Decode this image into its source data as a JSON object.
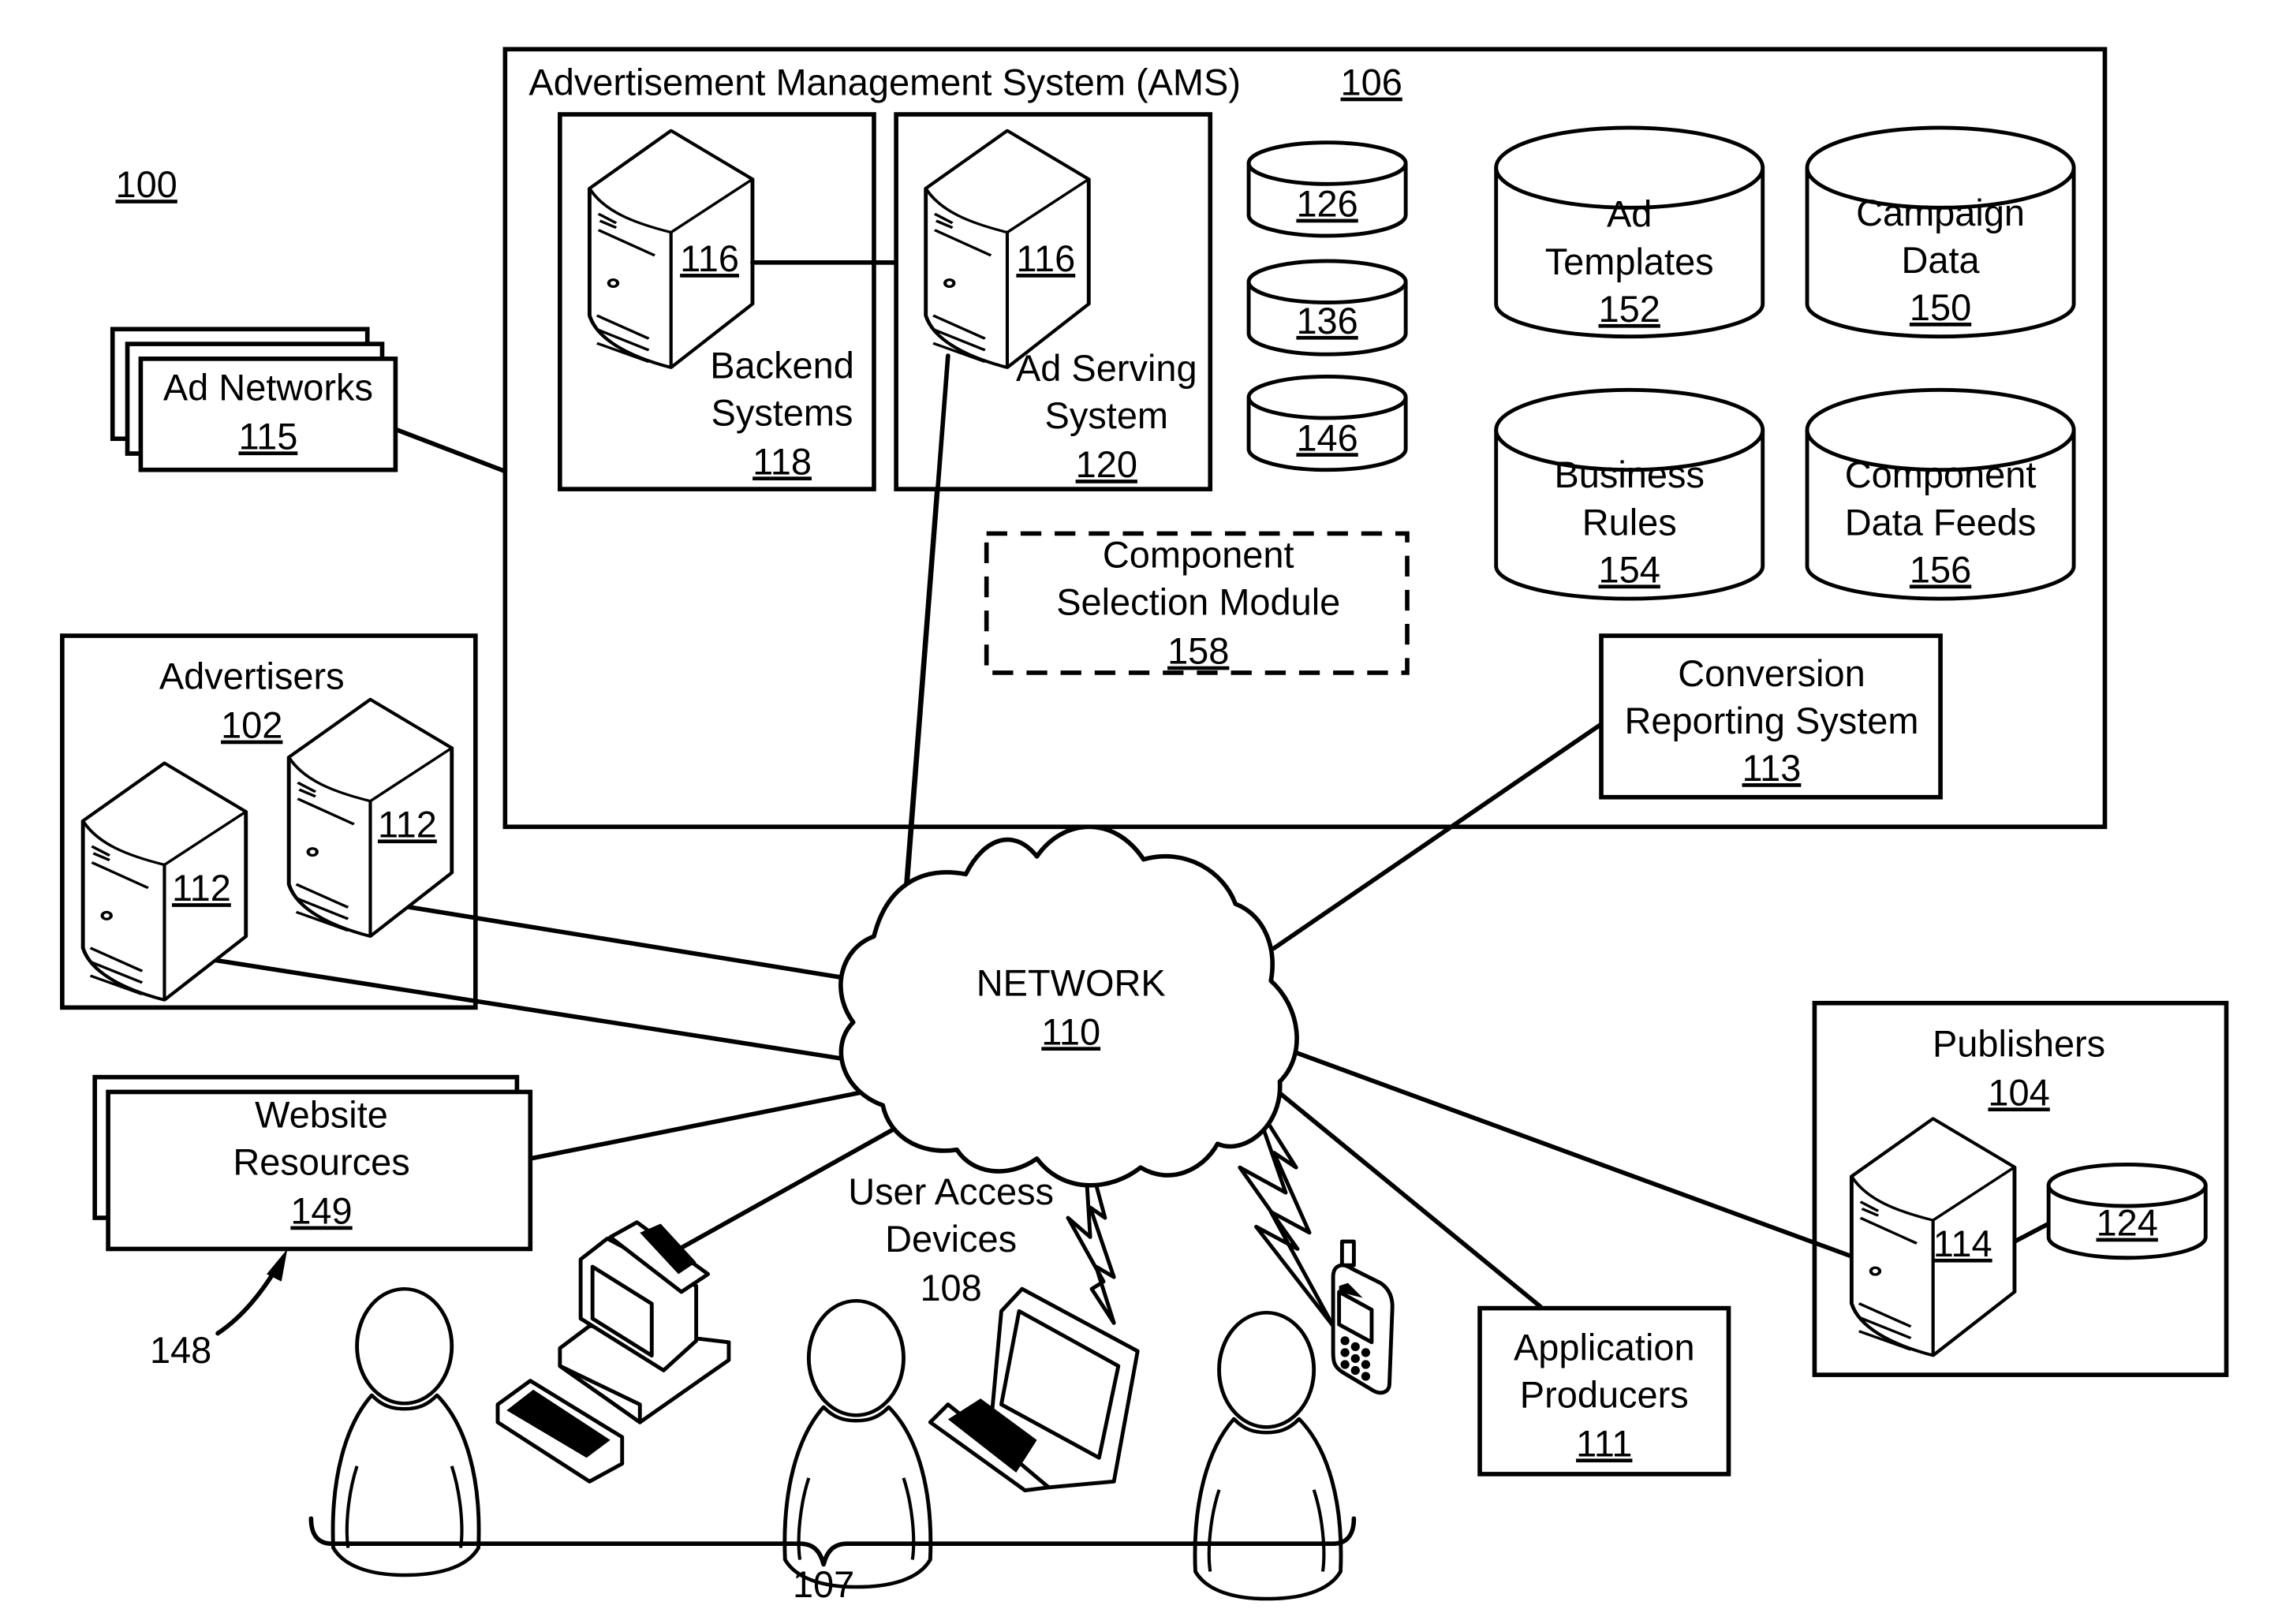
{
  "figure": {
    "ref": "100",
    "colors": {
      "line": "#000000",
      "background": "#ffffff"
    }
  },
  "ams": {
    "title": "Advertisement Management System (AMS)",
    "ref": "106"
  },
  "backend": {
    "line1": "Backend",
    "line2": "Systems",
    "ref": "118",
    "server_ref": "116"
  },
  "ad_serving": {
    "line1": "Ad Serving",
    "line2": "System",
    "ref": "120",
    "server_ref": "116"
  },
  "small_dbs": [
    {
      "ref": "126"
    },
    {
      "ref": "136"
    },
    {
      "ref": "146"
    }
  ],
  "data_stores": [
    {
      "line1": "Ad",
      "line2": "Templates",
      "ref": "152"
    },
    {
      "line1": "Campaign",
      "line2": "Data",
      "ref": "150"
    },
    {
      "line1": "Business",
      "line2": "Rules",
      "ref": "154"
    },
    {
      "line1": "Component",
      "line2": "Data Feeds",
      "ref": "156"
    }
  ],
  "component_selection": {
    "line1": "Component",
    "line2": "Selection Module",
    "ref": "158"
  },
  "conversion_reporting": {
    "line1": "Conversion",
    "line2": "Reporting System",
    "ref": "113"
  },
  "ad_networks": {
    "label": "Ad Networks",
    "ref": "115"
  },
  "advertisers": {
    "label": "Advertisers",
    "ref": "102",
    "server_refs": [
      "112",
      "112"
    ]
  },
  "website_resources": {
    "line1": "Website",
    "line2": "Resources",
    "ref": "149",
    "pointer_ref": "148"
  },
  "network": {
    "label": "NETWORK",
    "ref": "110"
  },
  "user_access_devices": {
    "line1": "User Access",
    "line2": "Devices",
    "ref": "108"
  },
  "users_group": {
    "ref": "107"
  },
  "application_producers": {
    "line1": "Application",
    "line2": "Producers",
    "ref": "111"
  },
  "publishers": {
    "label": "Publishers",
    "ref": "104",
    "server_ref": "114",
    "db_ref": "124"
  }
}
